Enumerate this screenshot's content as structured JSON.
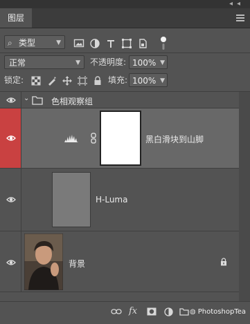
{
  "panel": {
    "collapse_arrows": "◂◂",
    "close_mark": "✕",
    "tab_label": "图层"
  },
  "filter_row": {
    "search_glyph": "⌕",
    "filter_type": "类型",
    "icons": [
      "image-filter-icon",
      "adjustment-filter-icon",
      "type-filter-icon",
      "shape-filter-icon",
      "smart-object-filter-icon",
      "filter-toggle-icon"
    ]
  },
  "blend_row": {
    "blend_mode": "正常",
    "opacity_label": "不透明度:",
    "opacity_value": "100%"
  },
  "lock_row": {
    "lock_label": "锁定:",
    "fill_label": "填充:",
    "fill_value": "100%",
    "icons": [
      "lock-transparent-pixels-icon",
      "lock-image-pixels-icon",
      "lock-position-icon",
      "lock-artboard-icon",
      "lock-all-icon"
    ]
  },
  "layers": [
    {
      "name": "色相观察组",
      "kind": "group",
      "expanded": true
    },
    {
      "name": "黑白滑块到山脚",
      "kind": "adjustment",
      "selected": true,
      "eye_highlight": "#c94141"
    },
    {
      "name": "H-Luma",
      "kind": "pixel",
      "thumb_color": "#7a7a7a"
    },
    {
      "name": "背景",
      "kind": "background",
      "locked": true
    }
  ],
  "bottom_bar": {
    "icons": [
      "link-layers-icon",
      "fx-icon",
      "add-mask-icon",
      "new-fill-adjustment-icon",
      "new-group-icon",
      "new-layer-icon",
      "delete-layer-icon"
    ],
    "fx_label": "fx",
    "watermark": "PhotoshopTea"
  },
  "colors": {
    "panel_bg": "#535353",
    "selected_row": "#686868",
    "eye_highlight": "#c94141"
  }
}
